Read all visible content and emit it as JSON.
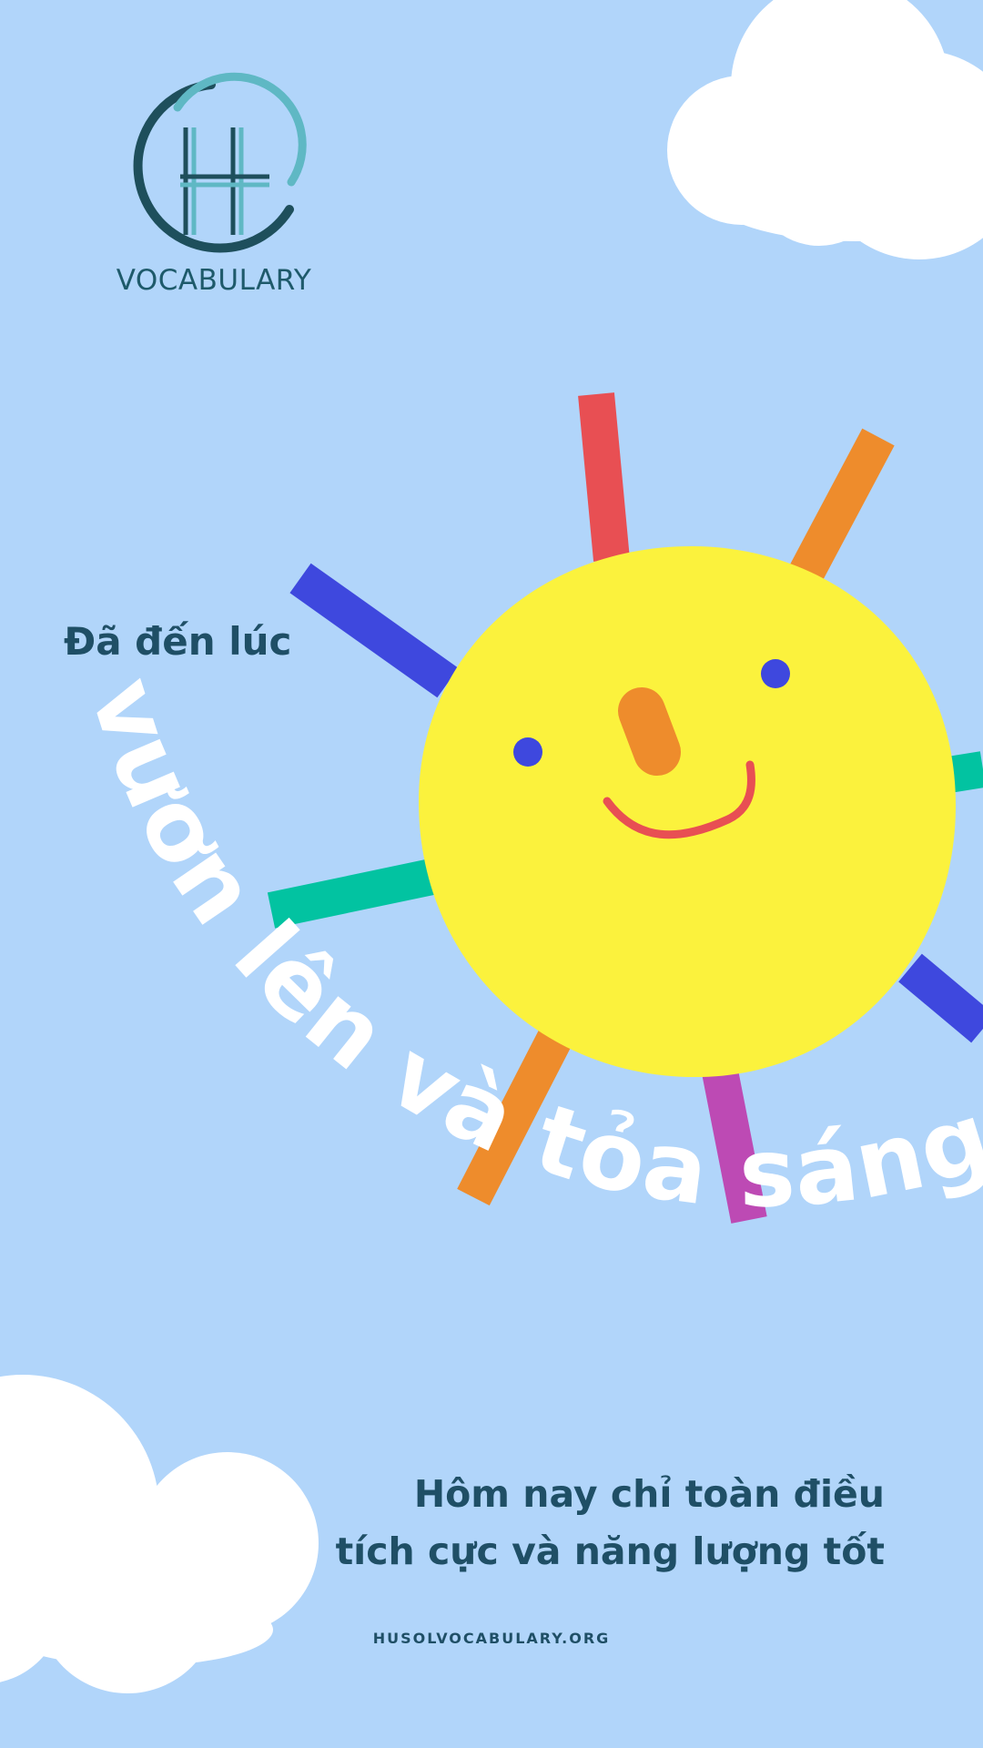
{
  "colors": {
    "background": "#b1d5fa",
    "cloud": "#ffffff",
    "sun": "#fbf23d",
    "eye": "#3e48de",
    "nose": "#ee8c2c",
    "smile": "#e84f53",
    "text_dark": "#1f4f66",
    "logo_dark": "#1e4f5c",
    "logo_light": "#5fb8c4"
  },
  "rays": [
    {
      "name": "red",
      "color": "#e84f53"
    },
    {
      "name": "orange-top",
      "color": "#ee8c2c"
    },
    {
      "name": "teal-right",
      "color": "#02c3a1"
    },
    {
      "name": "blue-lower-right",
      "color": "#3e48de"
    },
    {
      "name": "purple-bottom",
      "color": "#bd4ab4"
    },
    {
      "name": "orange-bottom",
      "color": "#ee8c2c"
    },
    {
      "name": "teal-left",
      "color": "#02c3a1"
    },
    {
      "name": "blue-left",
      "color": "#3e48de"
    }
  ],
  "logo": {
    "brand_text": "VOCABULARY"
  },
  "headline": {
    "eyebrow": "Đã đến lúc",
    "arc_text": "vươn lên và tỏa sáng"
  },
  "tagline": {
    "line1": "Hôm nay chỉ toàn điều",
    "line2": "tích cực và năng lượng tốt"
  },
  "footer": {
    "website": "HUSOLVOCABULARY.ORG"
  }
}
